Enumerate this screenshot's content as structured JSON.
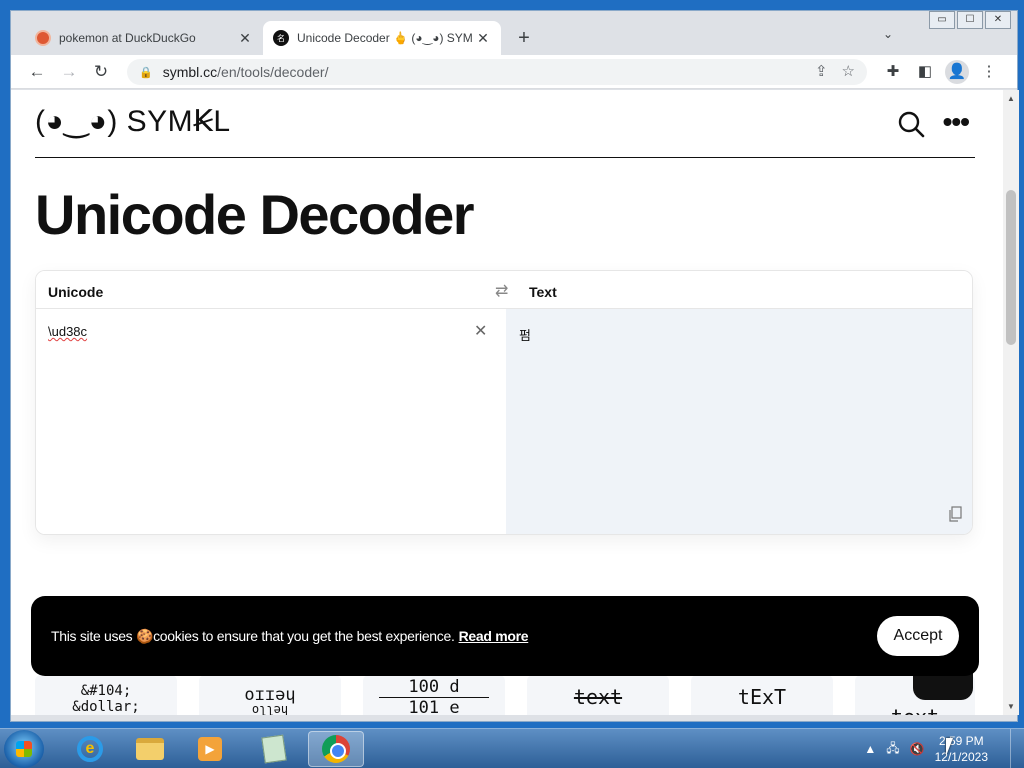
{
  "browser": {
    "tabs": [
      {
        "title": "pokemon at DuckDuckGo",
        "close": "✕"
      },
      {
        "title": "Unicode Decoder 🖕 (◕‿◕) SYM",
        "close": "✕"
      }
    ],
    "new_tab": "+",
    "tab_search": "⌄",
    "url_host": "symbl.cc",
    "url_path": "/en/tools/decoder/",
    "window_controls": [
      "▭",
      "☐",
      "✕"
    ]
  },
  "site": {
    "logo": "(◕‿◕) SYMꞢL",
    "more": "•••"
  },
  "page": {
    "title": "Unicode Decoder"
  },
  "decoder": {
    "left_label": "Unicode",
    "right_label": "Text",
    "swap_symbol": "⇄",
    "input_value": "\\ud38c",
    "clear_symbol": "✕",
    "output_value": "펌"
  },
  "cards": [
    {
      "line1": "&#104;",
      "line2": "&dollar;"
    },
    {
      "line1": "oɪɪǝɥ",
      "line2": "hello"
    },
    {
      "line1": "100 d",
      "line2": "101 e"
    },
    {
      "line1": "text",
      "line2": ""
    },
    {
      "line1": "tExT",
      "line2": ""
    },
    {
      "line1": "",
      "line2": "text"
    }
  ],
  "cookie": {
    "text": "This site uses 🍪cookies to ensure that you get the best experience.",
    "link": "Read more",
    "accept": "Accept"
  },
  "taskbar": {
    "time": "2:59 PM",
    "date": "12/1/2023"
  }
}
